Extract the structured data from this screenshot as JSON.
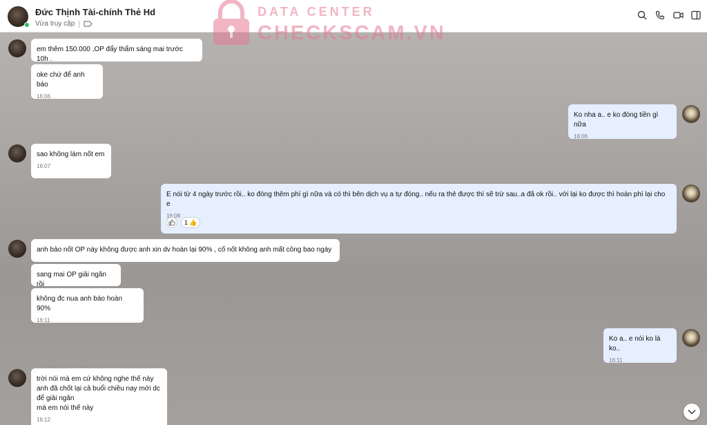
{
  "header": {
    "contact_name": "Đức Thịnh Tài-chính Thẻ Hd",
    "status": "Vừa truy cập",
    "actions": [
      "search-icon",
      "phone-icon",
      "video-icon",
      "sidebar-icon"
    ]
  },
  "watermark": {
    "line1": "DATA CENTER",
    "line2": "CHECKSCAM.VN"
  },
  "messages": [
    {
      "text": "em thêm 150.000 ,OP đẩy thẩm sáng mai trước 10h .",
      "time": ""
    },
    {
      "text": "oke chứ để anh báo",
      "time": "16:06"
    },
    {
      "text": "Ko nha a.. e ko đóng tiền gì nữa",
      "time": "16:06"
    },
    {
      "text": "sao không làm nốt em",
      "time": "16:07"
    },
    {
      "text": "E nói từ 4 ngày trước rồi.. ko đóng thêm phí gì nữa và có thì bên dịch vụ a tự đóng.. nếu ra thẻ được thì sẽ trừ sau..a đã ok rồi.. với lại ko được thì hoàn phí lại cho e",
      "time": "16:08"
    },
    {
      "text": "anh bảo nốt OP này không được anh xin dv hoàn lại 90% , cố nốt không anh mất công bao ngày",
      "time": ""
    },
    {
      "text": "sang mai OP giải ngân rồi",
      "time": ""
    },
    {
      "text": "không đc nua anh báo hoàn 90%",
      "time": "16:11"
    },
    {
      "text": "Ko a.. e nói ko là ko..",
      "time": "16:11"
    },
    {
      "text": "trời nói mà em cứ không nghe thế này\nanh đã chốt lại cả buổi chiều nay mới dc để giải ngân\nmà em nói thế này",
      "time": "16:12"
    }
  ],
  "reaction": {
    "like_icon": "thumbs-up-icon",
    "count": "1",
    "emoji": "👍"
  },
  "colors": {
    "incoming_bubble": "#ffffff",
    "outgoing_bubble": "#e5efff",
    "online": "#2bbd5a",
    "watermark": "#e77a94"
  }
}
